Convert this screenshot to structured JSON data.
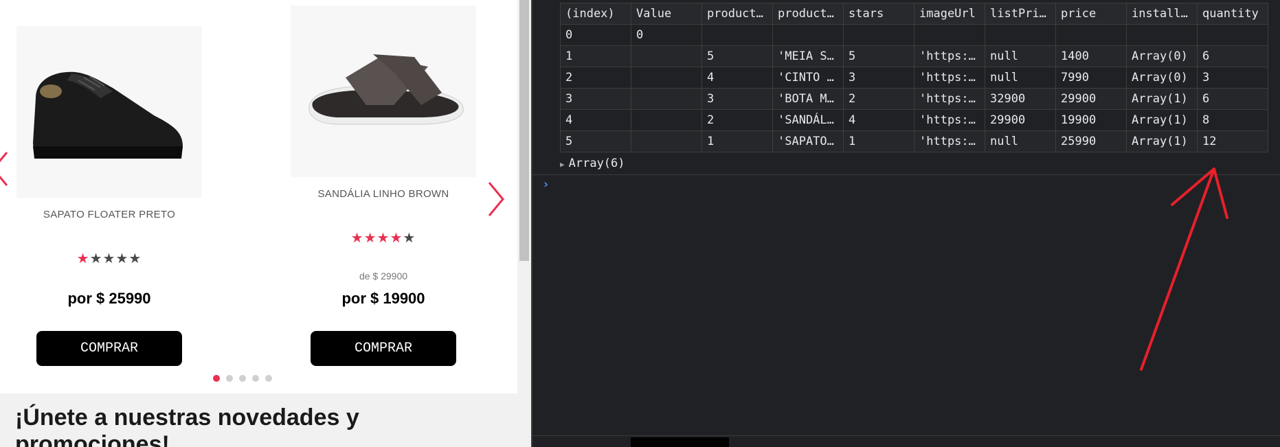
{
  "store": {
    "products": [
      {
        "name": "SAPATO FLOATER PRETO",
        "image": "black-shoe-image",
        "stars": 1,
        "stars_max": 5,
        "list_price": "",
        "price": "por $ 25990",
        "buy_label": "COMPRAR"
      },
      {
        "name": "SANDÁLIA LINHO BROWN",
        "image": "brown-sandal-image",
        "stars": 4,
        "stars_max": 5,
        "list_price": "de $ 29900",
        "price": "por $ 19900",
        "buy_label": "COMPRAR"
      }
    ],
    "carousel": {
      "dot_count": 5,
      "active_dot": 0
    },
    "newsletter_title": "¡Únete a nuestras novedades y promociones!",
    "accent_color": "#e8304f"
  },
  "console": {
    "columns": [
      "(index)",
      "Value",
      "product…",
      "product…",
      "stars",
      "imageUrl",
      "listPri…",
      "price",
      "install…",
      "quantity"
    ],
    "rows": [
      [
        "0",
        "0",
        "",
        "",
        "",
        "",
        "",
        "",
        "",
        ""
      ],
      [
        "1",
        "",
        "5",
        "'MEIA S…",
        "5",
        "'https:…",
        "null",
        "1400",
        "Array(0)",
        "6"
      ],
      [
        "2",
        "",
        "4",
        "'CINTO …",
        "3",
        "'https:…",
        "null",
        "7990",
        "Array(0)",
        "3"
      ],
      [
        "3",
        "",
        "3",
        "'BOTA M…",
        "2",
        "'https:…",
        "32900",
        "29900",
        "Array(1)",
        "6"
      ],
      [
        "4",
        "",
        "2",
        "'SANDÁL…",
        "4",
        "'https:…",
        "29900",
        "19900",
        "Array(1)",
        "8"
      ],
      [
        "5",
        "",
        "1",
        "'SAPATO…",
        "1",
        "'https:…",
        "null",
        "25990",
        "Array(1)",
        "12"
      ]
    ],
    "summary": "Array(6)",
    "prompt_symbol": "›",
    "colors": {
      "number": "#9980ff",
      "string": "#35d4c7",
      "null": "#80868b",
      "prompt": "#4c8bf5"
    }
  },
  "annotation": {
    "type": "red-arrow",
    "points_to": "quantity-column",
    "color": "#e8202a"
  }
}
